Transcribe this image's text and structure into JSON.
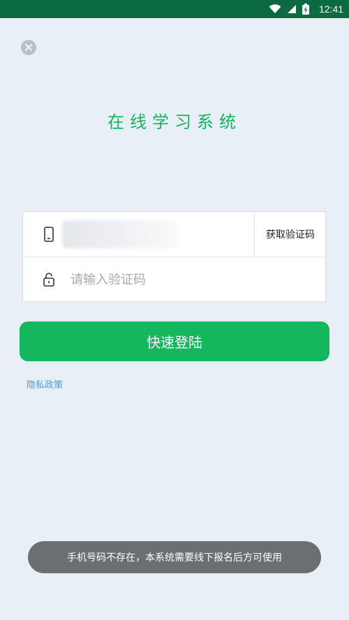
{
  "status_bar": {
    "time": "12:41",
    "icons": [
      "wifi-icon",
      "cellular-signal-icon",
      "battery-charging-icon"
    ]
  },
  "close_icon": "close-icon",
  "app": {
    "title": "在线学习系统"
  },
  "form": {
    "phone_icon": "phone-icon",
    "phone_value": "",
    "get_code_label": "获取验证码",
    "code_icon": "unlock-icon",
    "code_placeholder": "请输入验证码"
  },
  "login_button": {
    "label": "快速登陆"
  },
  "privacy_link": {
    "label": "隐私政策"
  },
  "toast": {
    "message": "手机号码不存在，本系统需要线下报名后方可使用"
  },
  "colors": {
    "status_bar": "#0b6a3f",
    "background": "#e8eff6",
    "brand_green": "#14b65e",
    "link_blue": "#4a9de0",
    "toast_bg": "#6b6f71"
  }
}
